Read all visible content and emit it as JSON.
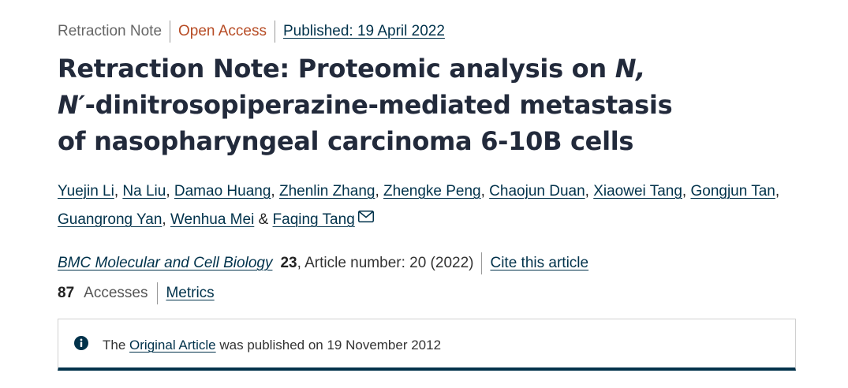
{
  "article_meta": {
    "type": "Retraction Note",
    "access": "Open Access",
    "published": "Published: 19 April 2022"
  },
  "title": {
    "part1": "Retraction Note: Proteomic analysis on ",
    "italic": "N, N′",
    "part2": "-dinitrosopiperazine-mediated metastasis of nasopharyngeal carcinoma 6-10B cells"
  },
  "authors": [
    "Yuejin Li",
    "Na Liu",
    "Damao Huang",
    "Zhenlin Zhang",
    "Zhengke Peng",
    "Chaojun Duan",
    "Xiaowei Tang",
    "Gongjun Tan",
    "Guangrong Yan",
    "Wenhua Mei",
    "Faqing Tang"
  ],
  "author_separators": {
    "comma": ", ",
    "and": " & "
  },
  "journal": {
    "name": "BMC Molecular and Cell Biology",
    "volume": "23",
    "article_info": ", Article number: 20 (2022)",
    "cite_label": "Cite this article"
  },
  "metrics": {
    "accesses_count": "87",
    "accesses_label": "Accesses",
    "metrics_label": "Metrics"
  },
  "notice": {
    "prefix": "The ",
    "link": "Original Article",
    "suffix": " was published on 19 November 2012",
    "icon": "info-icon"
  },
  "colors": {
    "link": "#01324b",
    "open_access": "#b74c25",
    "title": "#222a3b",
    "notice_border": "#01324b"
  }
}
